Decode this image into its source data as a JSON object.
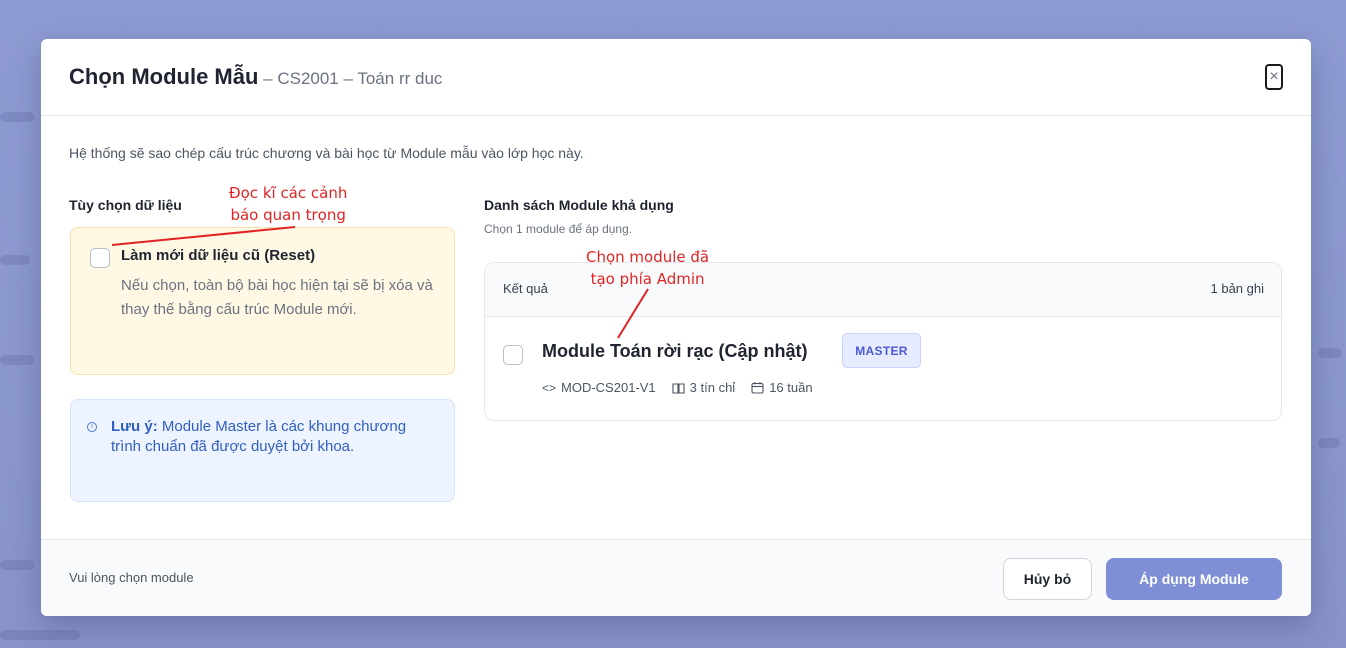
{
  "modal": {
    "title": "Chọn Module Mẫu",
    "subtitle": " – CS2001 – Toán rr duc",
    "close_icon": "×",
    "intro": "Hệ thống sẽ sao chép cấu trúc chương và bài học từ Module mẫu vào lớp học này."
  },
  "left_panel": {
    "heading": "Tùy chọn dữ liệu",
    "reset": {
      "title": "Làm mới dữ liệu cũ (Reset)",
      "description": "Nếu chọn, toàn bộ bài học hiện tại sẽ bị xóa và thay thế bằng cấu trúc Module mới."
    },
    "note": {
      "icon": "info-icon",
      "label": "Lưu ý:",
      "text": " Module Master là các khung chương trình chuẩn đã được duyệt bởi khoa."
    }
  },
  "right_panel": {
    "heading": "Danh sách Module khả dụng",
    "subheading": "Chọn 1 module để áp dụng.",
    "results_label": "Kết quả",
    "results_count": "1 bản ghi",
    "modules": [
      {
        "name": "Module Toán rời rạc (Cập nhật)",
        "badge": "MASTER",
        "code": "MOD-CS201-V1",
        "credits": "3 tín chỉ",
        "weeks": "16 tuần"
      }
    ]
  },
  "footer": {
    "hint": "Vui lòng chọn module",
    "cancel_label": "Hủy bỏ",
    "apply_label": "Áp dụng Module"
  },
  "annotations": {
    "left_note": "Đọc kĩ các cảnh\nbáo quan trọng",
    "right_note": "Chọn module đã\ntạo phía Admin"
  },
  "colors": {
    "overlay": "#8f9bd0",
    "accent": "#7f8fd6",
    "badge_text": "#4c5bd4",
    "warning_bg": "#fff8e5",
    "info_bg": "#eef4ff",
    "annotation": "#e02424"
  }
}
